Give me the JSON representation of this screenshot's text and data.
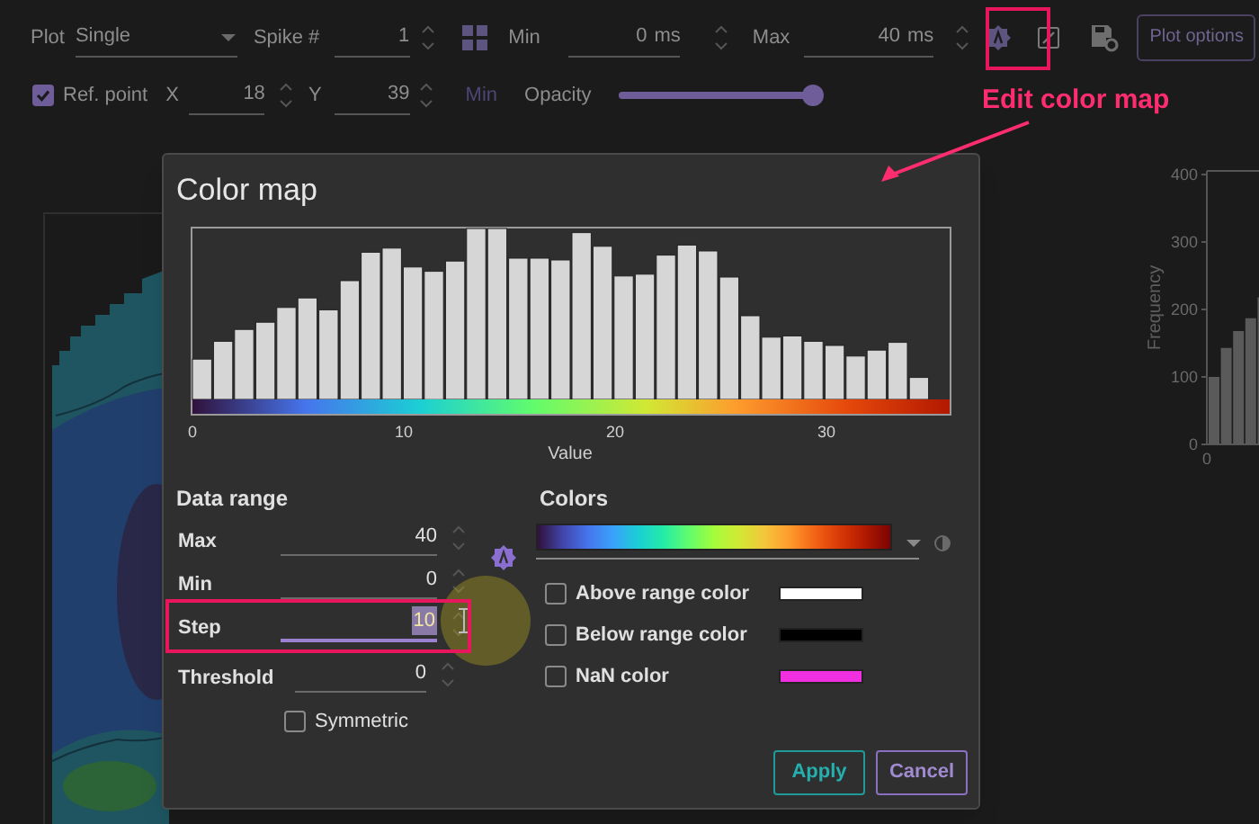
{
  "toolbar": {
    "plot_label": "Plot",
    "plot_select": "Single",
    "spike_label": "Spike #",
    "spike_value": "1",
    "min_label": "Min",
    "min_value": "0",
    "min_unit": "ms",
    "max_label": "Max",
    "max_value": "40",
    "max_unit": "ms",
    "plot_options": "Plot options"
  },
  "toolbar_row2": {
    "ref_point": {
      "label": "Ref. point",
      "checked": true
    },
    "x_label": "X",
    "x_value": "18",
    "y_label": "Y",
    "y_value": "39",
    "min_button": "Min",
    "opacity": {
      "label": "Opacity",
      "level": 0.97
    }
  },
  "annotation": {
    "text": "Edit color map"
  },
  "dialog": {
    "title": "Color map",
    "histogram": {
      "xticks": [
        "0",
        "10",
        "20",
        "30"
      ],
      "xlabel": "Value"
    },
    "data_range": {
      "title": "Data range",
      "fields": [
        {
          "label": "Max",
          "value": "40",
          "focused": false
        },
        {
          "label": "Min",
          "value": "0",
          "focused": false
        },
        {
          "label": "Step",
          "value": "10",
          "focused": true
        },
        {
          "label": "Threshold",
          "value": "0",
          "focused": false
        }
      ],
      "symmetric": {
        "label": "Symmetric",
        "checked": false
      }
    },
    "colors": {
      "title": "Colors",
      "options": [
        {
          "label": "Above range color",
          "checked": false,
          "color": "#ffffff"
        },
        {
          "label": "Below range color",
          "checked": false,
          "color": "#000000"
        },
        {
          "label": "NaN color",
          "checked": false,
          "color": "#f030e0"
        }
      ]
    },
    "buttons": [
      {
        "label": "Apply",
        "kind": "primary"
      },
      {
        "label": "Cancel",
        "kind": "secondary"
      }
    ]
  },
  "background_chart": {
    "ylabel": "Frequency",
    "yticks": [
      "400",
      "300",
      "200",
      "100",
      "0"
    ],
    "x_origin_label": "0"
  }
}
